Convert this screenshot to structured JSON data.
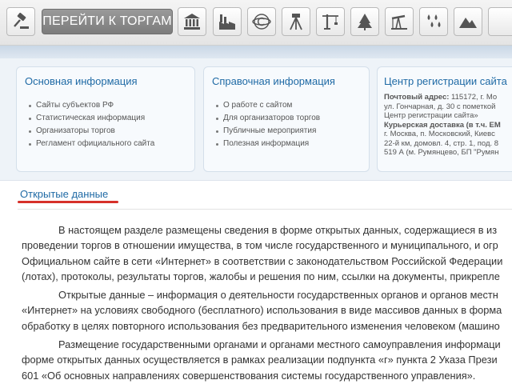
{
  "toolbar": {
    "go_button_label": "ПЕРЕЙТИ К ТОРГАМ",
    "icons": [
      "gavel-icon",
      "bank-building-icon",
      "factory-icon",
      "copyright-icon",
      "surveying-tripod-icon",
      "crane-icon",
      "forest-icon",
      "oil-pump-icon",
      "rain-icon",
      "mountains-icon"
    ]
  },
  "info": {
    "basic": {
      "title": "Основная информация",
      "items": [
        "Сайты субъектов РФ",
        "Статистическая информация",
        "Организаторы торгов",
        "Регламент официального сайта"
      ]
    },
    "reference": {
      "title": "Справочная информация",
      "items": [
        "О работе с сайтом",
        "Для организаторов торгов",
        "Публичные мероприятия",
        "Полезная информация"
      ]
    },
    "registration": {
      "title": "Центр регистрации сайта",
      "postal_label": "Почтовый адрес:",
      "postal_line1": " 115172, г. Мо",
      "postal_line2": "ул. Гончарная, д. 30 с пометкой",
      "postal_line3": "Центр регистрации сайта»",
      "courier_label": "Курьерская доставка (в т.ч. EM",
      "courier_line1": "г. Москва, п. Московский, Киевс",
      "courier_line2": "22-й км, домовл. 4, стр. 1, под. 8",
      "courier_line3": "519 А (м. Румянцево, БП \"Румян"
    }
  },
  "content": {
    "tab_label": "Открытые данные",
    "paragraphs": [
      [
        "В настоящем разделе размещены сведения в форме открытых данных, содержащиеся в из",
        "проведении торгов в отношении имущества, в том числе государственного и муниципального, и огр",
        "Официальном сайте в сети «Интернет» в соответствии с законодательством Российской Федерации",
        "(лотах), протоколы, результаты торгов, жалобы и решения по ним, ссылки на документы, прикрепле"
      ],
      [
        "Открытые данные – информация о деятельности государственных органов и органов местн",
        "«Интернет» на условиях свободного (бесплатного) использования в виде массивов данных в форма",
        "обработку в целях повторного использования без предварительного изменения человеком (машино"
      ],
      [
        "Размещение государственными органами и органами местного самоуправления информаци",
        "форме открытых данных осуществляется в рамках реализации подпункта «г» пункта 2 Указа Прези",
        "601 «Об основных направлениях совершенствования системы государственного управления»."
      ]
    ]
  }
}
